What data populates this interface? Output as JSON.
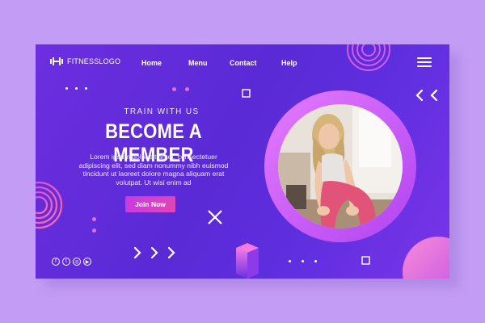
{
  "logo": {
    "text": "FITNESSLOGO"
  },
  "nav": {
    "items": [
      {
        "label": "Home"
      },
      {
        "label": "Menu"
      },
      {
        "label": "Contact"
      },
      {
        "label": "Help"
      }
    ]
  },
  "hero": {
    "tagline": "TRAIN WITH US",
    "headline": "BECOME A MEMBER",
    "body": "Lorem ipsum dolor sit amet, consectetuer adipiscing elit, sed diam nonummy nibh euismod tincidunt ut laoreet dolore magna aliquam erat volutpat. Ut wisi enim ad",
    "cta_label": "Join Now"
  },
  "social": {
    "icons": [
      "facebook-icon",
      "twitter-icon",
      "instagram-icon",
      "youtube-icon"
    ]
  },
  "colors": {
    "background": "#c39cf5",
    "card": "#5a2ad6",
    "accent": "#e045b6",
    "ring": "#c865f5"
  }
}
